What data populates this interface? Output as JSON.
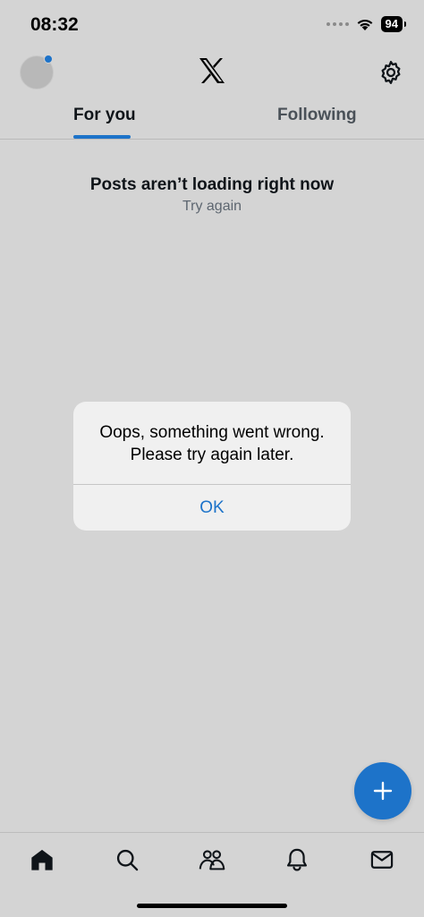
{
  "status_bar": {
    "time": "08:32",
    "battery": "94",
    "icons": [
      "signal-dots-icon",
      "wifi-icon",
      "battery-icon"
    ]
  },
  "header": {
    "logo": "x-logo-icon",
    "settings_icon": "gear-icon",
    "avatar_badge_color": "#1d73c9"
  },
  "tabs": [
    {
      "label": "For you",
      "active": true
    },
    {
      "label": "Following",
      "active": false
    }
  ],
  "feed_error": {
    "title": "Posts aren’t loading right now",
    "retry_label": "Try again"
  },
  "alert": {
    "message": "Oops, something went wrong. Please try again later.",
    "ok_label": "OK"
  },
  "fab": {
    "icon": "plus-icon"
  },
  "bottom_nav": [
    {
      "icon": "home-icon",
      "active": true
    },
    {
      "icon": "search-icon",
      "active": false
    },
    {
      "icon": "communities-icon",
      "active": false
    },
    {
      "icon": "bell-icon",
      "active": false
    },
    {
      "icon": "mail-icon",
      "active": false
    }
  ],
  "colors": {
    "accent": "#1d73c9",
    "background": "#d4d4d4",
    "dialog": "#f0f0f0"
  }
}
